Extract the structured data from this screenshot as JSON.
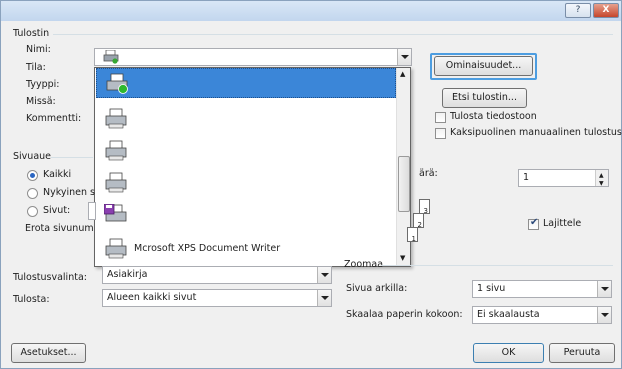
{
  "window": {
    "help_label": "?",
    "close_label": "X"
  },
  "printer_group": {
    "title": "Tulostin",
    "name_label": "Nimi:",
    "status_label": "Tila:",
    "type_label": "Tyyppi:",
    "where_label": "Missä:",
    "comment_label": "Kommentti:"
  },
  "printer_list": {
    "items": [
      {
        "label": "",
        "icon": "printer-ready-icon"
      },
      {
        "label": "",
        "icon": "printer-icon"
      },
      {
        "label": "",
        "icon": "printer-icon"
      },
      {
        "label": "",
        "icon": "printer-icon"
      },
      {
        "label": "",
        "icon": "fax-printer-icon"
      },
      {
        "label": "Mcrosoft XPS Document Writer",
        "icon": "printer-icon"
      }
    ]
  },
  "buttons": {
    "properties": "Ominaisuudet...",
    "find_printer": "Etsi tulostin...",
    "setup": "Asetukset...",
    "ok": "OK",
    "cancel": "Peruuta"
  },
  "checks": {
    "print_to_file": "Tulosta tiedostoon",
    "manual_duplex": "Kaksipuolinen manuaalinen tulostus",
    "collate": "Lajittele"
  },
  "pages_group": {
    "title": "Sivuaue",
    "all": "Kaikki",
    "current": "Nykyinen s",
    "pages": "Sivut:",
    "separator_hint": "Erota sivunum"
  },
  "copies": {
    "label_fragment": "ärä:",
    "value": "1",
    "page_numbers": [
      "1",
      "2",
      "3"
    ]
  },
  "zoom": {
    "title": "Zoomaa",
    "pages_per_sheet_label": "Sivua arkilla:",
    "pages_per_sheet_value": "1 sivu",
    "scale_label": "Skaalaa paperin kokoon:",
    "scale_value": "Ei skaalausta"
  },
  "print_what": {
    "label": "Tulostusvalinta:",
    "value": "Asiakirja"
  },
  "print": {
    "label": "Tulosta:",
    "value": "Alueen kaikki sivut"
  }
}
